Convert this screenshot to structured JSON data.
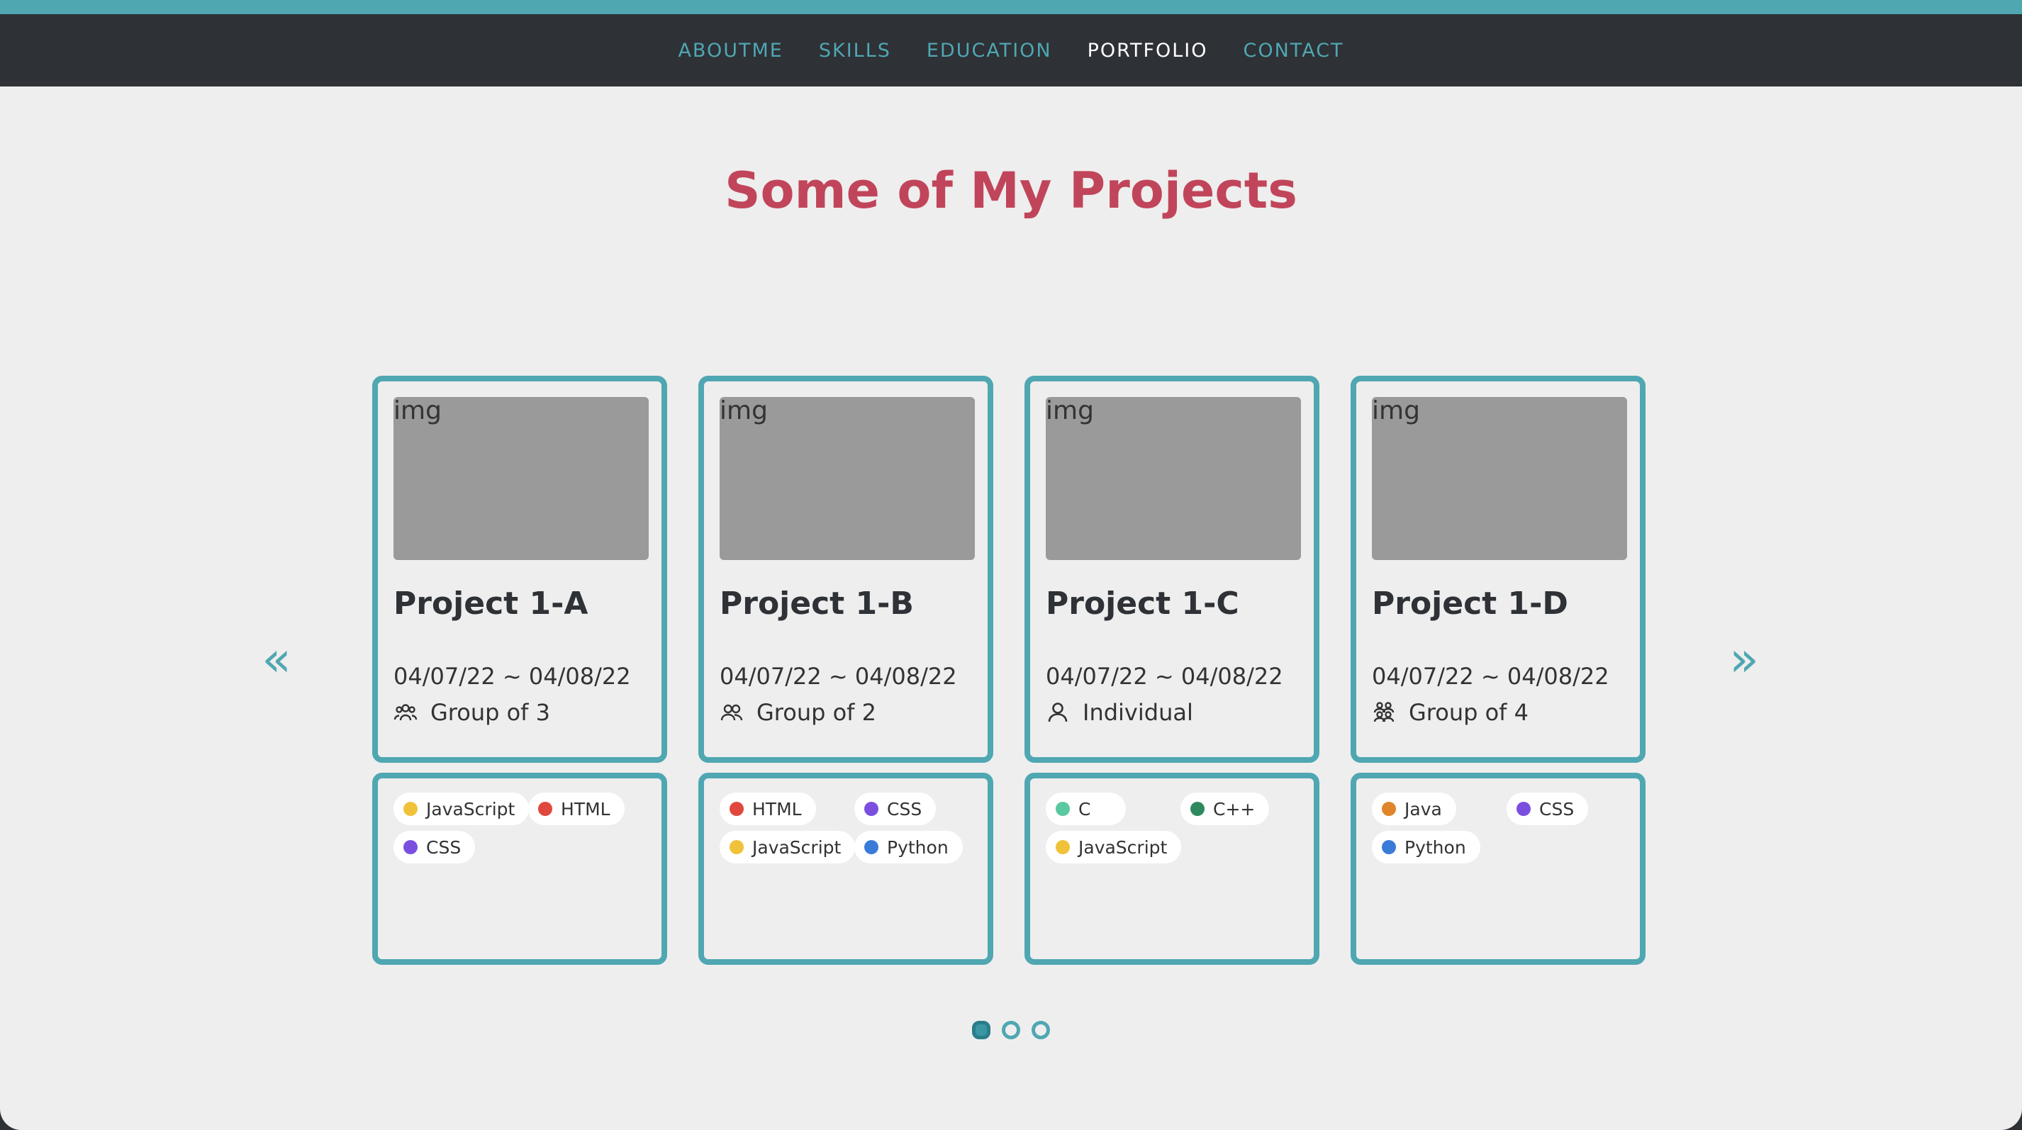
{
  "nav": {
    "items": [
      {
        "label": "ABOUTME",
        "active": false
      },
      {
        "label": "SKILLS",
        "active": false
      },
      {
        "label": "EDUCATION",
        "active": false
      },
      {
        "label": "PORTFOLIO",
        "active": true
      },
      {
        "label": "CONTACT",
        "active": false
      }
    ]
  },
  "heading": "Some of My Projects",
  "carousel": {
    "prev_icon": "double-chevron-left-icon",
    "next_icon": "double-chevron-right-icon",
    "pages": 3,
    "active_page": 1
  },
  "projects": [
    {
      "img_label": "img",
      "title": "Project 1-A",
      "dates": "04/07/22 ~ 04/08/22",
      "team": "Group of 3",
      "team_icon": "group-icon",
      "tags": [
        {
          "label": "JavaScript",
          "color": "#f0c23a"
        },
        {
          "label": "HTML",
          "color": "#e0483e"
        },
        {
          "label": "CSS",
          "color": "#7a4fe0"
        }
      ]
    },
    {
      "img_label": "img",
      "title": "Project 1-B",
      "dates": "04/07/22 ~ 04/08/22",
      "team": "Group of 2",
      "team_icon": "pair-icon",
      "tags": [
        {
          "label": "HTML",
          "color": "#e0483e"
        },
        {
          "label": "CSS",
          "color": "#7a4fe0"
        },
        {
          "label": "JavaScript",
          "color": "#f0c23a"
        },
        {
          "label": "Python",
          "color": "#3b7bd8"
        }
      ]
    },
    {
      "img_label": "img",
      "title": "Project 1-C",
      "dates": "04/07/22 ~ 04/08/22",
      "team": "Individual",
      "team_icon": "person-icon",
      "tags": [
        {
          "label": "C",
          "color": "#5ac8a0"
        },
        {
          "label": "C++",
          "color": "#2e8a5e"
        },
        {
          "label": "JavaScript",
          "color": "#f0c23a"
        }
      ]
    },
    {
      "img_label": "img",
      "title": "Project 1-D",
      "dates": "04/07/22 ~ 04/08/22",
      "team": "Group of 4",
      "team_icon": "group-of-four-icon",
      "tags": [
        {
          "label": "Java",
          "color": "#e0852a"
        },
        {
          "label": "CSS",
          "color": "#7a4fe0"
        },
        {
          "label": "Python",
          "color": "#3b7bd8"
        }
      ]
    }
  ]
}
